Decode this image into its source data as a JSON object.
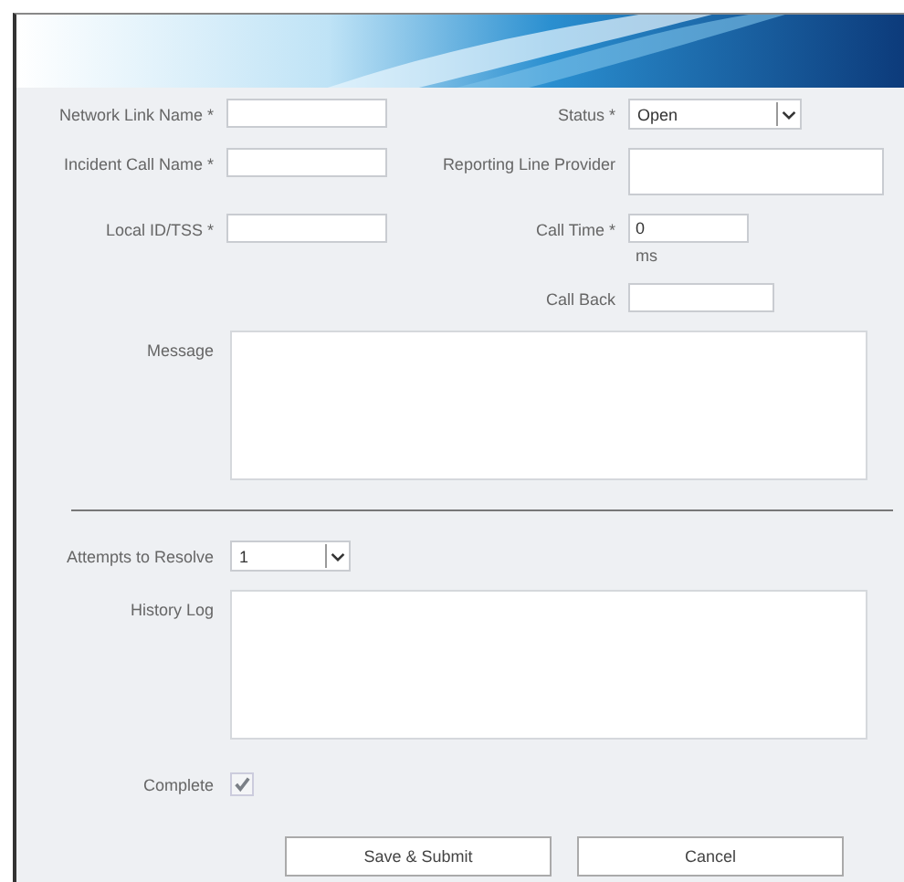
{
  "form": {
    "left_fields": [
      {
        "label": "Network Link Name *"
      },
      {
        "label": "Incident Call Name *"
      },
      {
        "label": "Local ID/TSS *"
      }
    ],
    "status": {
      "label": "Status *",
      "value": "Open"
    },
    "provider": {
      "label": "Reporting Line Provider"
    },
    "call_time": {
      "label": "Call Time *",
      "value": "0",
      "unit": "ms"
    },
    "call_back": {
      "label": "Call Back"
    },
    "message": {
      "label": "Message"
    },
    "attempts": {
      "label": "Attempts to Resolve",
      "value": "1"
    },
    "history": {
      "label": "History Log"
    },
    "complete": {
      "label": "Complete",
      "checked": true,
      "disabled": true
    },
    "buttons": [
      "Save & Submit",
      "Cancel"
    ]
  }
}
